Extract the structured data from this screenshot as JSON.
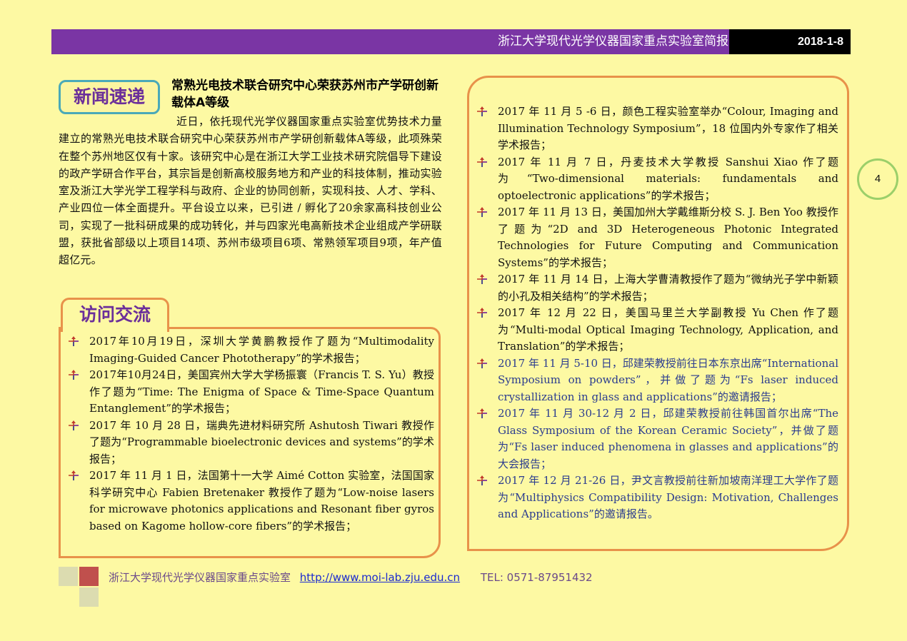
{
  "header": {
    "title": "浙江大学现代光学仪器国家重点实验室简报",
    "date": "2018-1-8"
  },
  "news": {
    "badge": "新闻速递",
    "title": "常熟光电技术联合研究中心荣获苏州市产学研创新载体A等级",
    "body": "近日，依托现代光学仪器国家重点实验室优势技术力量建立的常熟光电技术联合研究中心荣获苏州市产学研创新载体A等级，此项殊荣在整个苏州地区仅有十家。该研究中心是在浙江大学工业技术研究院倡导下建设的政产学研合作平台，其宗旨是创新高校服务地方和产业的科技体制，推动实验室及浙江大学光学工程学科与政府、企业的协同创新，实现科技、人才、学科、产业四位一体全面提升。平台设立以来，已引进 / 孵化了20余家高科技创业公司，实现了一批科研成果的成功转化，并与四家光电高新技术企业组成产学研联盟，获批省部级以上项目14项、苏州市级项目6项、常熟领军项目9项，年产值超亿元。"
  },
  "visits": {
    "badge": "访问交流",
    "left_items": [
      "2017年10月19日，深圳大学黄鹏教授作了题为“Multimodality Imaging-Guided Cancer Phototherapy”的学术报告；",
      "2017年10月24日，美国宾州大学大学杨振寰（Francis T. S. Yu）教授作了题为“Time: The Enigma of Space & Time-Space Quantum Entanglement”的学术报告；",
      "2017 年 10 月 28 日，瑞典先进材料研究所 Ashutosh Tiwari 教授作了题为“Programmable bioelectronic devices and systems”的学术报告；",
      "2017 年 11 月 1 日，法国第十一大学 Aimé Cotton 实验室，法国国家科学研究中心 Fabien Bretenaker 教授作了题为“Low-noise lasers for microwave photonics applications and Resonant fiber gyros based on Kagome hollow-core fibers”的学术报告；"
    ],
    "right_items": [
      {
        "text": "2017 年 11 月 5 -6 日，颜色工程实验室举办“Colour, Imaging and Illumination Technology Symposium”，18 位国内外专家作了相关学术报告；",
        "blue": false
      },
      {
        "text": "2017 年 11 月 7 日，丹麦技术大学教授 Sanshui Xiao 作了题为“Two-dimensional materials: fundamentals and optoelectronic applications”的学术报告；",
        "blue": false
      },
      {
        "text": "2017 年 11 月 13 日，美国加州大学戴维斯分校 S. J. Ben Yoo 教授作了题为“2D and 3D Heterogeneous Photonic Integrated Technologies for Future Computing and Communication Systems”的学术报告；",
        "blue": false
      },
      {
        "text": "2017 年 11 月 14 日，上海大学曹清教授作了题为“微纳光子学中新颖的小孔及相关结构”的学术报告；",
        "blue": false
      },
      {
        "text": "2017 年 12 月 22 日，美国马里兰大学副教授 Yu Chen 作了题为“Multi-modal Optical Imaging Technology, Application, and Translation”的学术报告；",
        "blue": false
      },
      {
        "text": "2017 年 11 月 5-10 日，邱建荣教授前往日本东京出席“International Symposium on powders”，并做了题为“Fs laser induced crystallization in glass and applications”的邀请报告；",
        "blue": true
      },
      {
        "text": "2017 年 11 月 30-12 月 2 日，邱建荣教授前往韩国首尔出席“The Glass Symposium of the Korean Ceramic Society”，并做了题为“Fs laser induced phenomena in glasses and applications”的大会报告；",
        "blue": true
      },
      {
        "text": "2017 年 12 月 21-26 日，尹文言教授前往新加坡南洋理工大学作了题为“Multiphysics Compatibility Design: Motivation, Challenges and Applications”的邀请报告。",
        "blue": true
      }
    ]
  },
  "page_number": "4",
  "footer": {
    "lab_name": "浙江大学现代光学仪器国家重点实验室",
    "url": "http://www.moi-lab.zju.edu.cn",
    "tel": "TEL: 0571-87951432"
  },
  "colors": {
    "background": "#fdf9a3",
    "header": "#7a35a4",
    "accent_orange": "#e8924a",
    "accent_teal": "#4aa9b8",
    "deco_red": "#c0504d",
    "deco_tan": "#dcdcb0"
  },
  "icons": {
    "bullet": "arrow-cross-bullet-icon"
  }
}
